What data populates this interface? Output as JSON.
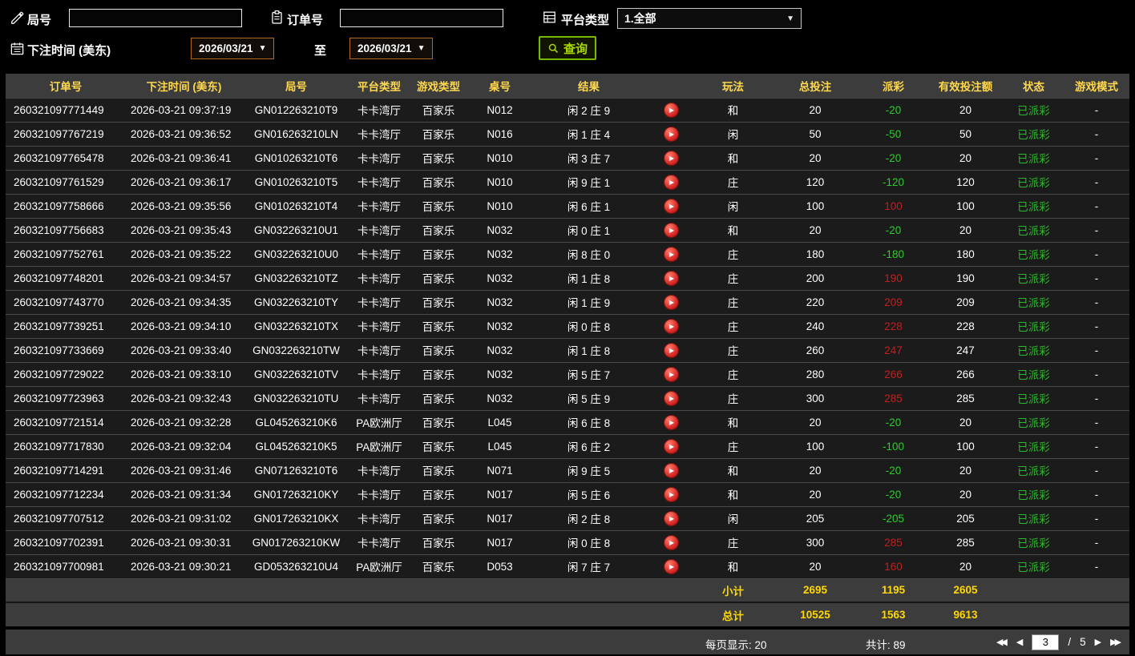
{
  "colors": {
    "header_yellow": "#ffd84d",
    "summary_yellow": "#ffd700",
    "payout_negative_green": "#2ecc2e",
    "payout_positive_red": "#c02020",
    "status_paid_green": "#2db82d",
    "search_button_green": "#76b900",
    "date_border_orange": "#b06a20",
    "row_bg": "#1b1b1b",
    "bar_bg": "#3c3c3c"
  },
  "icons": {
    "dropdown": "▼"
  },
  "filters": {
    "round": {
      "label": "局号",
      "value": ""
    },
    "order": {
      "label": "订单号",
      "value": ""
    },
    "platform": {
      "label": "平台类型",
      "value": "1.全部"
    },
    "bet_time_label": "下注时间 (美东)",
    "date_from": "2026/03/21",
    "to_label": "至",
    "date_to": "2026/03/21",
    "search_label": "查询"
  },
  "table": {
    "headers": [
      "订单号",
      "下注时间 (美东)",
      "局号",
      "平台类型",
      "游戏类型",
      "桌号",
      "结果",
      "",
      "玩法",
      "总投注",
      "派彩",
      "有效投注额",
      "状态",
      "游戏模式"
    ],
    "rows": [
      {
        "order_no": "260321097771449",
        "bet_time": "2026-03-21 09:37:19",
        "round_no": "GN012263210T9",
        "platform": "卡卡湾厅",
        "game_type": "百家乐",
        "table_no": "N012",
        "result": "闲 2 庄 9",
        "play_method": "和",
        "total_bet": "20",
        "payout": "-20",
        "payout_color": "green",
        "valid_bet": "20",
        "status": "已派彩",
        "game_mode": "-"
      },
      {
        "order_no": "260321097767219",
        "bet_time": "2026-03-21 09:36:52",
        "round_no": "GN016263210LN",
        "platform": "卡卡湾厅",
        "game_type": "百家乐",
        "table_no": "N016",
        "result": "闲 1 庄 4",
        "play_method": "闲",
        "total_bet": "50",
        "payout": "-50",
        "payout_color": "green",
        "valid_bet": "50",
        "status": "已派彩",
        "game_mode": "-"
      },
      {
        "order_no": "260321097765478",
        "bet_time": "2026-03-21 09:36:41",
        "round_no": "GN010263210T6",
        "platform": "卡卡湾厅",
        "game_type": "百家乐",
        "table_no": "N010",
        "result": "闲 3 庄 7",
        "play_method": "和",
        "total_bet": "20",
        "payout": "-20",
        "payout_color": "green",
        "valid_bet": "20",
        "status": "已派彩",
        "game_mode": "-"
      },
      {
        "order_no": "260321097761529",
        "bet_time": "2026-03-21 09:36:17",
        "round_no": "GN010263210T5",
        "platform": "卡卡湾厅",
        "game_type": "百家乐",
        "table_no": "N010",
        "result": "闲 9 庄 1",
        "play_method": "庄",
        "total_bet": "120",
        "payout": "-120",
        "payout_color": "green",
        "valid_bet": "120",
        "status": "已派彩",
        "game_mode": "-"
      },
      {
        "order_no": "260321097758666",
        "bet_time": "2026-03-21 09:35:56",
        "round_no": "GN010263210T4",
        "platform": "卡卡湾厅",
        "game_type": "百家乐",
        "table_no": "N010",
        "result": "闲 6 庄 1",
        "play_method": "闲",
        "total_bet": "100",
        "payout": "100",
        "payout_color": "red",
        "valid_bet": "100",
        "status": "已派彩",
        "game_mode": "-"
      },
      {
        "order_no": "260321097756683",
        "bet_time": "2026-03-21 09:35:43",
        "round_no": "GN032263210U1",
        "platform": "卡卡湾厅",
        "game_type": "百家乐",
        "table_no": "N032",
        "result": "闲 0 庄 1",
        "play_method": "和",
        "total_bet": "20",
        "payout": "-20",
        "payout_color": "green",
        "valid_bet": "20",
        "status": "已派彩",
        "game_mode": "-"
      },
      {
        "order_no": "260321097752761",
        "bet_time": "2026-03-21 09:35:22",
        "round_no": "GN032263210U0",
        "platform": "卡卡湾厅",
        "game_type": "百家乐",
        "table_no": "N032",
        "result": "闲 8 庄 0",
        "play_method": "庄",
        "total_bet": "180",
        "payout": "-180",
        "payout_color": "green",
        "valid_bet": "180",
        "status": "已派彩",
        "game_mode": "-"
      },
      {
        "order_no": "260321097748201",
        "bet_time": "2026-03-21 09:34:57",
        "round_no": "GN032263210TZ",
        "platform": "卡卡湾厅",
        "game_type": "百家乐",
        "table_no": "N032",
        "result": "闲 1 庄 8",
        "play_method": "庄",
        "total_bet": "200",
        "payout": "190",
        "payout_color": "red",
        "valid_bet": "190",
        "status": "已派彩",
        "game_mode": "-"
      },
      {
        "order_no": "260321097743770",
        "bet_time": "2026-03-21 09:34:35",
        "round_no": "GN032263210TY",
        "platform": "卡卡湾厅",
        "game_type": "百家乐",
        "table_no": "N032",
        "result": "闲 1 庄 9",
        "play_method": "庄",
        "total_bet": "220",
        "payout": "209",
        "payout_color": "red",
        "valid_bet": "209",
        "status": "已派彩",
        "game_mode": "-"
      },
      {
        "order_no": "260321097739251",
        "bet_time": "2026-03-21 09:34:10",
        "round_no": "GN032263210TX",
        "platform": "卡卡湾厅",
        "game_type": "百家乐",
        "table_no": "N032",
        "result": "闲 0 庄 8",
        "play_method": "庄",
        "total_bet": "240",
        "payout": "228",
        "payout_color": "red",
        "valid_bet": "228",
        "status": "已派彩",
        "game_mode": "-"
      },
      {
        "order_no": "260321097733669",
        "bet_time": "2026-03-21 09:33:40",
        "round_no": "GN032263210TW",
        "platform": "卡卡湾厅",
        "game_type": "百家乐",
        "table_no": "N032",
        "result": "闲 1 庄 8",
        "play_method": "庄",
        "total_bet": "260",
        "payout": "247",
        "payout_color": "red",
        "valid_bet": "247",
        "status": "已派彩",
        "game_mode": "-"
      },
      {
        "order_no": "260321097729022",
        "bet_time": "2026-03-21 09:33:10",
        "round_no": "GN032263210TV",
        "platform": "卡卡湾厅",
        "game_type": "百家乐",
        "table_no": "N032",
        "result": "闲 5 庄 7",
        "play_method": "庄",
        "total_bet": "280",
        "payout": "266",
        "payout_color": "red",
        "valid_bet": "266",
        "status": "已派彩",
        "game_mode": "-"
      },
      {
        "order_no": "260321097723963",
        "bet_time": "2026-03-21 09:32:43",
        "round_no": "GN032263210TU",
        "platform": "卡卡湾厅",
        "game_type": "百家乐",
        "table_no": "N032",
        "result": "闲 5 庄 9",
        "play_method": "庄",
        "total_bet": "300",
        "payout": "285",
        "payout_color": "red",
        "valid_bet": "285",
        "status": "已派彩",
        "game_mode": "-"
      },
      {
        "order_no": "260321097721514",
        "bet_time": "2026-03-21 09:32:28",
        "round_no": "GL045263210K6",
        "platform": "PA欧洲厅",
        "game_type": "百家乐",
        "table_no": "L045",
        "result": "闲 6 庄 8",
        "play_method": "和",
        "total_bet": "20",
        "payout": "-20",
        "payout_color": "green",
        "valid_bet": "20",
        "status": "已派彩",
        "game_mode": "-"
      },
      {
        "order_no": "260321097717830",
        "bet_time": "2026-03-21 09:32:04",
        "round_no": "GL045263210K5",
        "platform": "PA欧洲厅",
        "game_type": "百家乐",
        "table_no": "L045",
        "result": "闲 6 庄 2",
        "play_method": "庄",
        "total_bet": "100",
        "payout": "-100",
        "payout_color": "green",
        "valid_bet": "100",
        "status": "已派彩",
        "game_mode": "-"
      },
      {
        "order_no": "260321097714291",
        "bet_time": "2026-03-21 09:31:46",
        "round_no": "GN071263210T6",
        "platform": "卡卡湾厅",
        "game_type": "百家乐",
        "table_no": "N071",
        "result": "闲 9 庄 5",
        "play_method": "和",
        "total_bet": "20",
        "payout": "-20",
        "payout_color": "green",
        "valid_bet": "20",
        "status": "已派彩",
        "game_mode": "-"
      },
      {
        "order_no": "260321097712234",
        "bet_time": "2026-03-21 09:31:34",
        "round_no": "GN017263210KY",
        "platform": "卡卡湾厅",
        "game_type": "百家乐",
        "table_no": "N017",
        "result": "闲 5 庄 6",
        "play_method": "和",
        "total_bet": "20",
        "payout": "-20",
        "payout_color": "green",
        "valid_bet": "20",
        "status": "已派彩",
        "game_mode": "-"
      },
      {
        "order_no": "260321097707512",
        "bet_time": "2026-03-21 09:31:02",
        "round_no": "GN017263210KX",
        "platform": "卡卡湾厅",
        "game_type": "百家乐",
        "table_no": "N017",
        "result": "闲 2 庄 8",
        "play_method": "闲",
        "total_bet": "205",
        "payout": "-205",
        "payout_color": "green",
        "valid_bet": "205",
        "status": "已派彩",
        "game_mode": "-"
      },
      {
        "order_no": "260321097702391",
        "bet_time": "2026-03-21 09:30:31",
        "round_no": "GN017263210KW",
        "platform": "卡卡湾厅",
        "game_type": "百家乐",
        "table_no": "N017",
        "result": "闲 0 庄 8",
        "play_method": "庄",
        "total_bet": "300",
        "payout": "285",
        "payout_color": "red",
        "valid_bet": "285",
        "status": "已派彩",
        "game_mode": "-"
      },
      {
        "order_no": "260321097700981",
        "bet_time": "2026-03-21 09:30:21",
        "round_no": "GD053263210U4",
        "platform": "PA欧洲厅",
        "game_type": "百家乐",
        "table_no": "D053",
        "result": "闲 7 庄 7",
        "play_method": "和",
        "total_bet": "20",
        "payout": "160",
        "payout_color": "red",
        "valid_bet": "20",
        "status": "已派彩",
        "game_mode": "-"
      }
    ],
    "subtotal": {
      "label": "小计",
      "total_bet": "2695",
      "payout": "1195",
      "valid_bet": "2605"
    },
    "total": {
      "label": "总计",
      "total_bet": "10525",
      "payout": "1563",
      "valid_bet": "9613"
    }
  },
  "pagination": {
    "per_page_label": "每页显示:",
    "per_page_value": "20",
    "records_label": "共计:",
    "records_value": "89",
    "current_page": "3",
    "slash": "/",
    "total_pages": "5",
    "icons": {
      "first": "◀◀",
      "prev": "◀",
      "next": "▶",
      "last": "▶▶"
    }
  }
}
